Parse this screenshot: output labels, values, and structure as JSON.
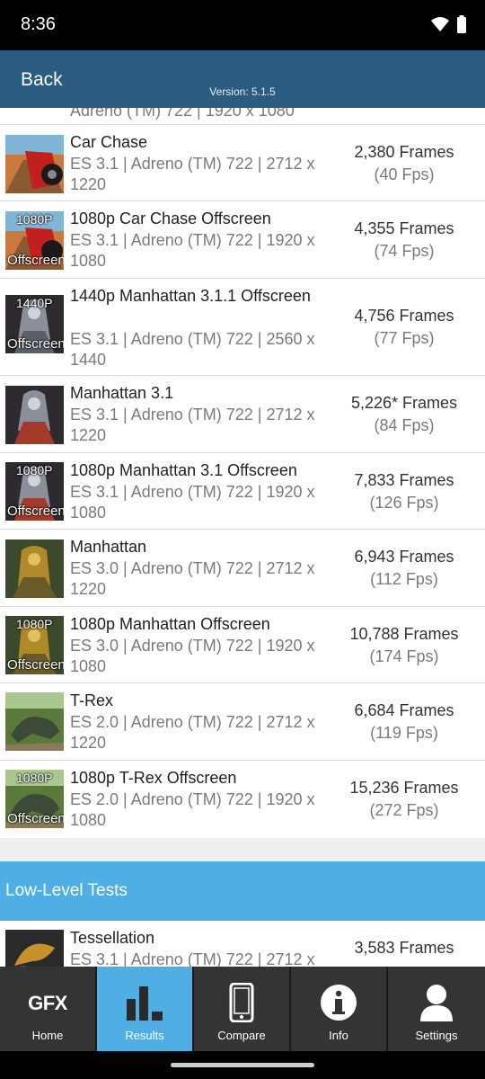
{
  "status_bar": {
    "time": "8:36"
  },
  "header": {
    "back_label": "Back",
    "version": "Version: 5.1.5"
  },
  "clipped_row_sub": "Adreno (TM) 722 | 1920 x 1080",
  "tests": [
    {
      "title": "Car Chase",
      "sub": "ES 3.1 | Adreno (TM) 722 | 2712 x 1220",
      "score": "2,380 Frames",
      "fps": "(40 Fps)"
    },
    {
      "title": "1080p Car Chase Offscreen",
      "sub": "ES 3.1 | Adreno (TM) 722 | 1920 x 1080",
      "score": "4,355 Frames",
      "fps": "(74 Fps)",
      "badge_top": "1080P",
      "badge_bottom": "Offscreen"
    },
    {
      "title": "1440p Manhattan 3.1.1 Offscreen",
      "sub": "ES 3.1 | Adreno (TM) 722 | 2560 x 1440",
      "score": "4,756 Frames",
      "fps": "(77 Fps)",
      "badge_top": "1440P",
      "badge_bottom": "Offscreen"
    },
    {
      "title": "Manhattan 3.1",
      "sub": "ES 3.1 | Adreno (TM) 722 | 2712 x 1220",
      "score": "5,226* Frames",
      "fps": "(84 Fps)"
    },
    {
      "title": "1080p Manhattan 3.1 Offscreen",
      "sub": "ES 3.1 | Adreno (TM) 722 | 1920 x 1080",
      "score": "7,833 Frames",
      "fps": "(126 Fps)",
      "badge_top": "1080P",
      "badge_bottom": "Offscreen"
    },
    {
      "title": "Manhattan",
      "sub": "ES 3.0 | Adreno (TM) 722 | 2712 x 1220",
      "score": "6,943 Frames",
      "fps": "(112 Fps)"
    },
    {
      "title": "1080p Manhattan Offscreen",
      "sub": "ES 3.0 | Adreno (TM) 722 | 1920 x 1080",
      "score": "10,788 Frames",
      "fps": "(174 Fps)",
      "badge_top": "1080P",
      "badge_bottom": "Offscreen"
    },
    {
      "title": "T-Rex",
      "sub": "ES 2.0 | Adreno (TM) 722 | 2712 x 1220",
      "score": "6,684 Frames",
      "fps": "(119 Fps)"
    },
    {
      "title": "1080p T-Rex Offscreen",
      "sub": "ES 2.0 | Adreno (TM) 722 | 1920 x 1080",
      "score": "15,236 Frames",
      "fps": "(272 Fps)",
      "badge_top": "1080P",
      "badge_bottom": "Offscreen"
    }
  ],
  "low_level": {
    "section_title": "Low-Level Tests",
    "tests": [
      {
        "title": "Tessellation",
        "sub": "ES 3.1 | Adreno (TM) 722 | 2712 x",
        "score": "3,583 Frames"
      }
    ]
  },
  "nav": {
    "logo_text": "GFX",
    "items": [
      {
        "label": "Home",
        "icon": "gfx-logo-icon"
      },
      {
        "label": "Results",
        "icon": "bar-chart-icon",
        "active": true
      },
      {
        "label": "Compare",
        "icon": "phone-icon"
      },
      {
        "label": "Info",
        "icon": "info-icon"
      },
      {
        "label": "Settings",
        "icon": "user-icon"
      }
    ]
  },
  "colors": {
    "header": "#2b5d82",
    "accent": "#4faee4",
    "nav_bg": "#343434"
  }
}
